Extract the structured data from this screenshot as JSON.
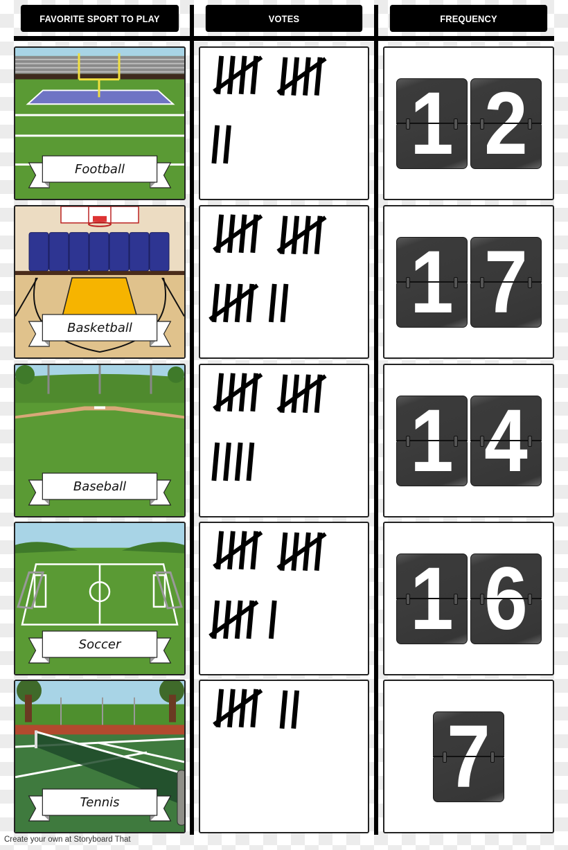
{
  "table": {
    "headers": {
      "sport": "FAVORITE SPORT TO PLAY",
      "votes": "VOTES",
      "frequency": "FREQUENCY"
    },
    "rows": [
      {
        "sport": "Football",
        "scene": "football-field-scene",
        "tally": 12,
        "frequency": "12",
        "digits": [
          "1",
          "2"
        ]
      },
      {
        "sport": "Basketball",
        "scene": "basketball-court-scene",
        "tally": 17,
        "frequency": "17",
        "digits": [
          "1",
          "7"
        ]
      },
      {
        "sport": "Baseball",
        "scene": "baseball-field-scene",
        "tally": 14,
        "frequency": "14",
        "digits": [
          "1",
          "4"
        ]
      },
      {
        "sport": "Soccer",
        "scene": "soccer-field-scene",
        "tally": 16,
        "frequency": "16",
        "digits": [
          "1",
          "6"
        ]
      },
      {
        "sport": "Tennis",
        "scene": "tennis-court-scene",
        "tally": 7,
        "frequency": "7",
        "digits": [
          "7"
        ]
      }
    ]
  },
  "footer": "Create your own at Storyboard That",
  "colors": {
    "header_bg": "#000000",
    "header_text": "#ffffff",
    "flip_card": "#3b3b3b",
    "grass": "#4f8f2f",
    "sky": "#a8d4e6"
  }
}
